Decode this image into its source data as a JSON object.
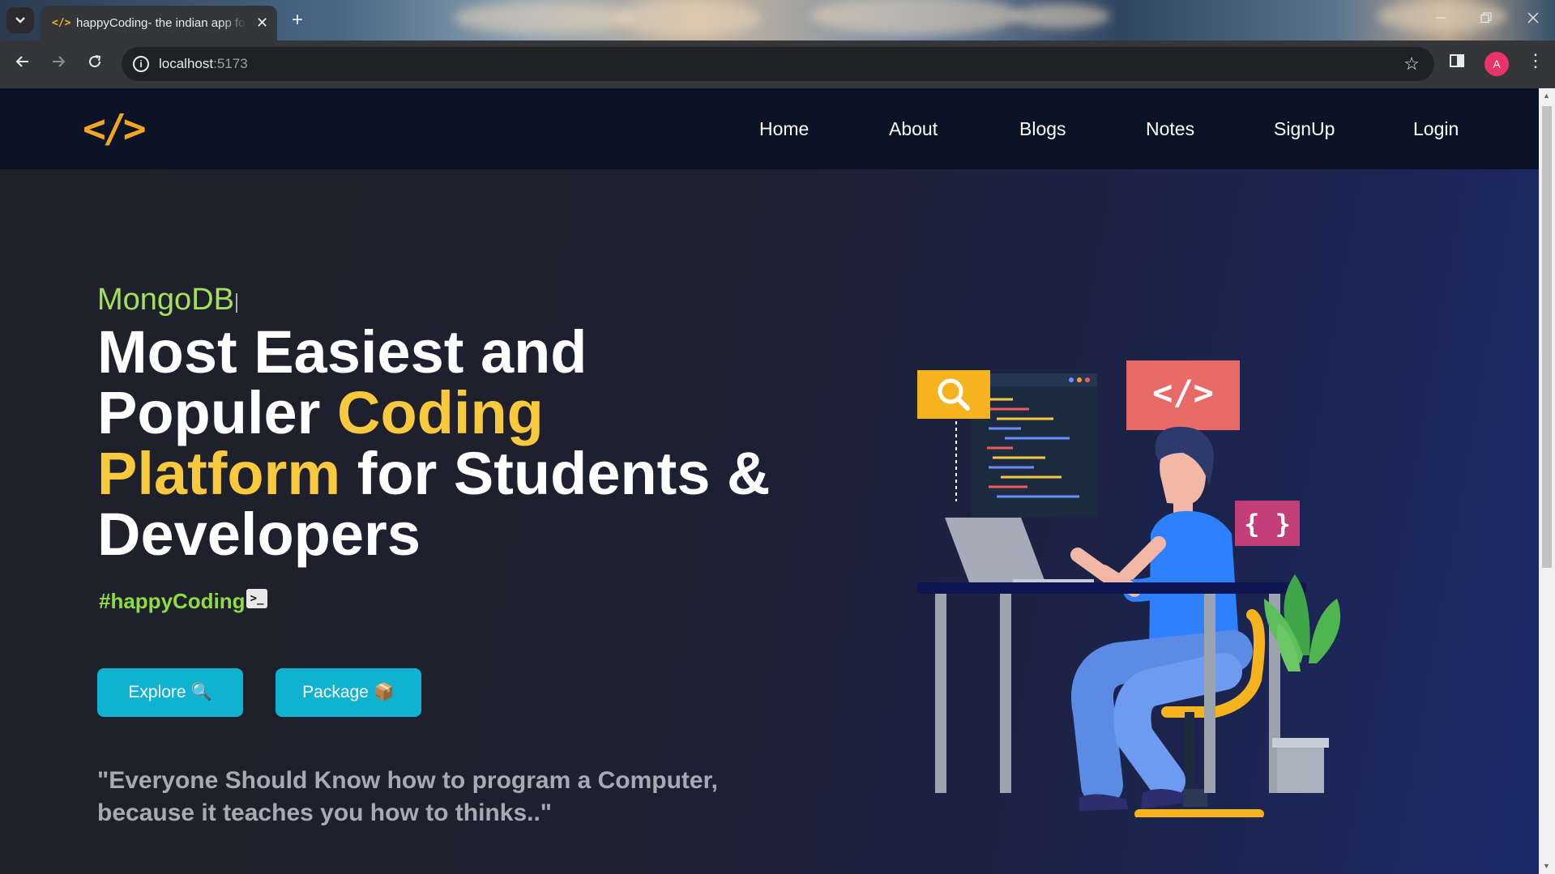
{
  "browser": {
    "tab_title": "happyCoding- the indian app for coders",
    "tab_favicon": "</>",
    "url_host": "localhost",
    "url_port": ":5173",
    "profile_initial": "A",
    "icons": {
      "tab_search": "chevron-down-icon",
      "close": "close-icon",
      "new_tab": "plus-icon",
      "back": "arrow-left-icon",
      "forward": "arrow-right-icon",
      "reload": "reload-icon",
      "site_info": "info-icon",
      "bookmark": "star-icon",
      "side_panel": "side-panel-icon",
      "menu": "more-vert-icon"
    }
  },
  "navbar": {
    "logo": "</>",
    "links": [
      "Home",
      "About",
      "Blogs",
      "Notes",
      "SignUp",
      "Login"
    ]
  },
  "hero": {
    "kicker": "MongoDB",
    "headline_1": "Most Easiest and",
    "headline_2": "Populer ",
    "headline_hl1": "Coding",
    "headline_hl2": "Platform",
    "headline_3": " for Students &",
    "headline_4": "Developers",
    "hashtag": "#happyCoding",
    "terminal_icon": ">_",
    "buttons": {
      "explore": "Explore 🔍",
      "package": "Package 📦"
    },
    "quote_line1": "\"Everyone Should Know how to program a Computer,",
    "quote_line2": "because it teaches you how to thinks..\""
  },
  "illustration": {
    "code_badge": "</>",
    "braces_badge": "{ }"
  },
  "colors": {
    "accent_yellow": "#f8c93c",
    "accent_green": "#a4e05a",
    "button_cyan": "#0fb3cf",
    "navbar_bg": "#0b1327",
    "logo_orange": "#f5a524"
  }
}
